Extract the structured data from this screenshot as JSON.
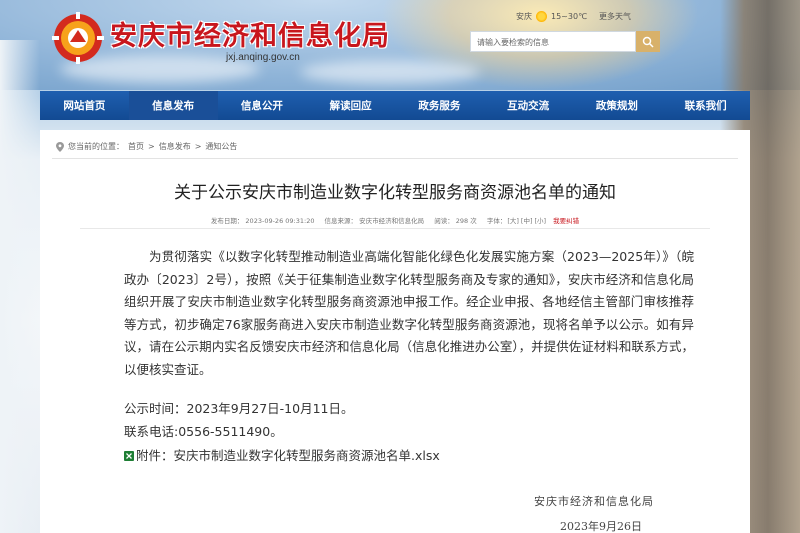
{
  "header": {
    "site_title": "安庆市经济和信息化局",
    "site_domain": "jxj.anqing.gov.cn",
    "weather_city": "安庆",
    "weather_temp": "15~30℃",
    "weather_link": "更多天气",
    "search_placeholder": "请输入要检索的信息"
  },
  "nav": {
    "items": [
      {
        "label": "网站首页"
      },
      {
        "label": "信息发布"
      },
      {
        "label": "信息公开"
      },
      {
        "label": "解读回应"
      },
      {
        "label": "政务服务"
      },
      {
        "label": "互动交流"
      },
      {
        "label": "政策规划"
      },
      {
        "label": "联系我们"
      }
    ]
  },
  "breadcrumb": {
    "prefix": "您当前的位置：",
    "items": [
      "首页",
      "信息发布",
      "通知公告"
    ],
    "separator": ">"
  },
  "article": {
    "title": "关于公示安庆市制造业数字化转型服务商资源池名单的通知",
    "meta": {
      "publish_time": "发布日期： 2023-09-26 09:31:20",
      "source": "信息来源： 安庆市经济和信息化局",
      "views": "阅读： 298 次",
      "font_label": "字体：",
      "font_large": "[大]",
      "font_medium": "[中]",
      "font_small": "[小]",
      "report_error": "我要纠错"
    },
    "body": "为贯彻落实《以数字化转型推动制造业高端化智能化绿色化发展实施方案（2023—2025年）》（皖政办〔2023〕2号），按照《关于征集制造业数字化转型服务商及专家的通知》，安庆市经济和信息化局组织开展了安庆市制造业数字化转型服务商资源池申报工作。经企业申报、各地经信主管部门审核推荐等方式，初步确定76家服务商进入安庆市制造业数字化转型服务商资源池，现将名单予以公示。如有异议，请在公示期内实名反馈安庆市经济和信息化局（信息化推进办公室），并提供佐证材料和联系方式，以便核实查证。",
    "notice_period": "公示时间：2023年9月27日-10月11日。",
    "phone": "联系电话:0556-5511490。",
    "attachment": "附件：安庆市制造业数字化转型服务商资源池名单.xlsx",
    "signature_org": "安庆市经济和信息化局",
    "signature_date": "2023年9月26日"
  },
  "colors": {
    "brand_red": "#c8161d",
    "nav_blue": "#1a5aa8"
  }
}
